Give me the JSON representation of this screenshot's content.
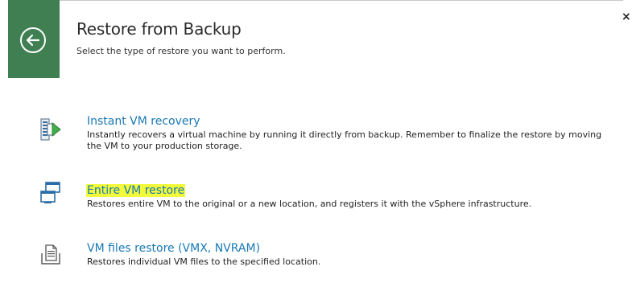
{
  "header": {
    "title": "Restore from Backup",
    "subtitle": "Select the type of restore you want to perform.",
    "close_glyph": "×",
    "accent_color": "#3f7f52"
  },
  "options": [
    {
      "icon": "instant-recovery-icon",
      "label": "Instant VM recovery",
      "description": "Instantly recovers a virtual machine by running it directly from backup. Remember to finalize the restore by moving the VM to your production storage.",
      "highlighted": false
    },
    {
      "icon": "entire-vm-restore-icon",
      "label": "Entire VM restore",
      "description": "Restores entire VM to the original or a new location, and registers it with the vSphere infrastructure.",
      "highlighted": true
    },
    {
      "icon": "vm-files-restore-icon",
      "label": "VM files restore (VMX, NVRAM)",
      "description": "Restores individual VM files to the specified location.",
      "highlighted": false
    }
  ],
  "colors": {
    "link": "#1a78b4",
    "highlight": "#f2fb3b"
  }
}
